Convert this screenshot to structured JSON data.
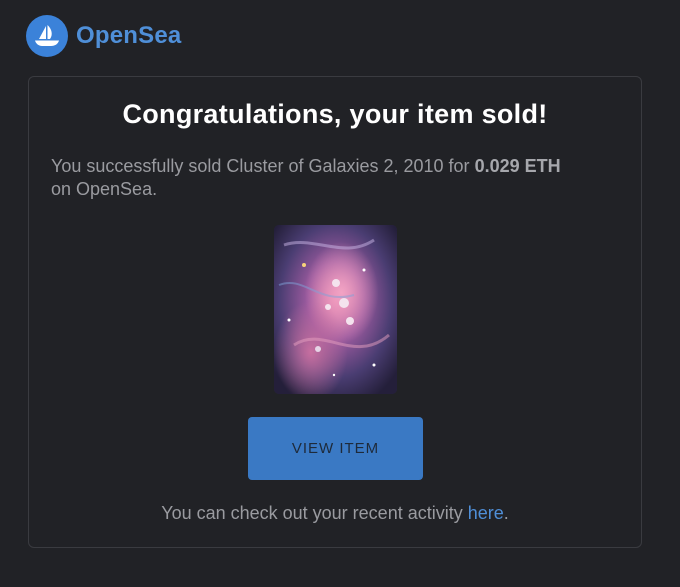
{
  "brand": {
    "name": "OpenSea",
    "logo_icon": "sailboat-icon",
    "color": "#3b82d9"
  },
  "headline": "Congratulations, your item sold!",
  "message": {
    "prefix": "You successfully sold Cluster of Galaxies 2, 2010 for ",
    "price": "0.029 ETH",
    "suffix": "on OpenSea."
  },
  "artwork": {
    "icon": "nft-artwork-image"
  },
  "button": {
    "label": "VIEW ITEM",
    "color": "#3a79c4"
  },
  "footer": {
    "prefix": "You can check out your recent activity ",
    "link_label": "here",
    "suffix": "."
  }
}
